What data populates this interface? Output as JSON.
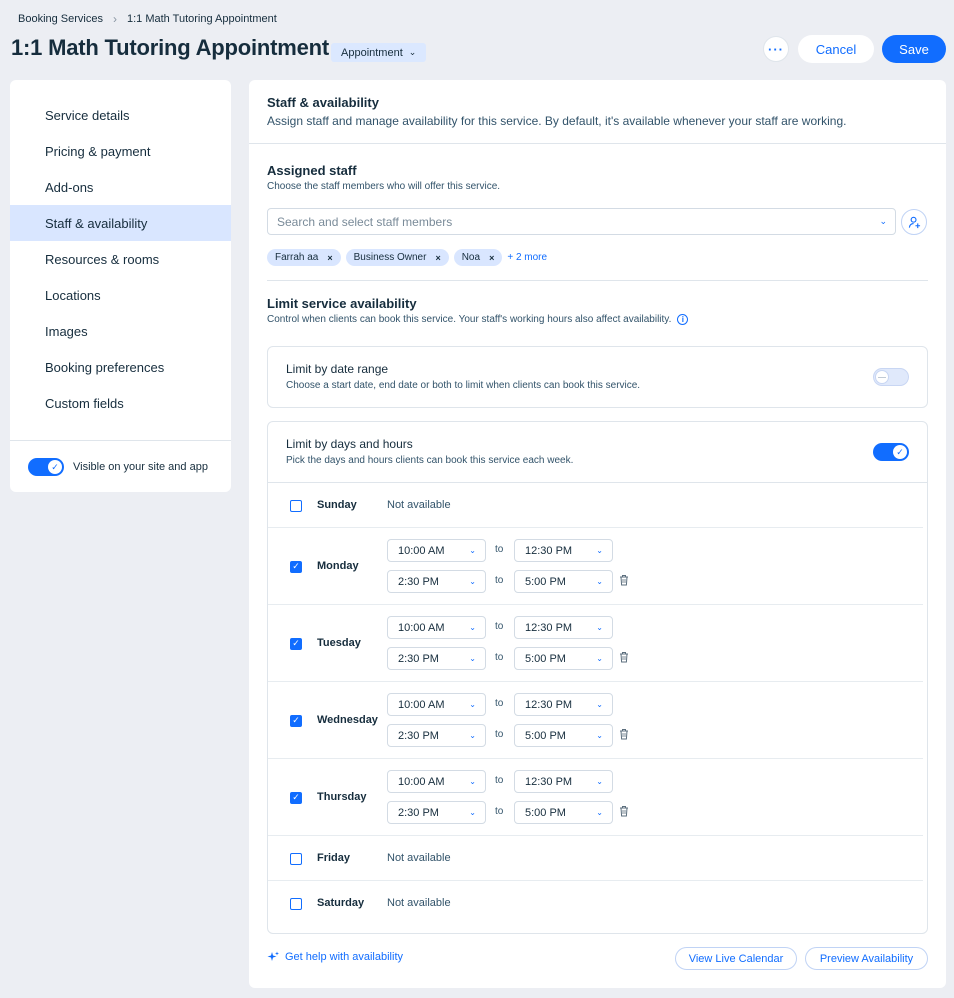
{
  "breadcrumb": {
    "root": "Booking Services",
    "separator": "›",
    "current": "1:1 Math Tutoring Appointment"
  },
  "header": {
    "title": "1:1 Math Tutoring Appointment",
    "type_badge": "Appointment",
    "more_label": "···",
    "cancel_label": "Cancel",
    "save_label": "Save"
  },
  "sidebar": {
    "items": [
      {
        "label": "Service details",
        "active": false
      },
      {
        "label": "Pricing & payment",
        "active": false
      },
      {
        "label": "Add-ons",
        "active": false
      },
      {
        "label": "Staff & availability",
        "active": true
      },
      {
        "label": "Resources & rooms",
        "active": false
      },
      {
        "label": "Locations",
        "active": false
      },
      {
        "label": "Images",
        "active": false
      },
      {
        "label": "Booking preferences",
        "active": false
      },
      {
        "label": "Custom fields",
        "active": false
      }
    ],
    "visible_label": "Visible on your site and app",
    "visible_on": true
  },
  "section": {
    "title": "Staff & availability",
    "subtitle": "Assign staff and manage availability for this service. By default, it's available whenever your staff are working."
  },
  "staff": {
    "title": "Assigned staff",
    "subtitle": "Choose the staff members who will offer this service.",
    "search_placeholder": "Search and select staff members",
    "chips": [
      "Farrah aa",
      "Business Owner",
      "Noa"
    ],
    "more_label": "+ 2 more"
  },
  "limit": {
    "title": "Limit service availability",
    "subtitle": "Control when clients can book this service. Your staff's working hours also affect availability.",
    "date_range": {
      "title": "Limit by date range",
      "subtitle": "Choose a start date, end date or both to limit when clients can book this service.",
      "enabled": false
    },
    "days_hours": {
      "title": "Limit by days and hours",
      "subtitle": "Pick the days and hours clients can book this service each week.",
      "enabled": true
    }
  },
  "to_label": "to",
  "days": [
    {
      "name": "Sunday",
      "checked": false,
      "not_available": "Not available",
      "slots": []
    },
    {
      "name": "Monday",
      "checked": true,
      "slots": [
        {
          "from": "10:00 AM",
          "to": "12:30 PM"
        },
        {
          "from": "2:30 PM",
          "to": "5:00 PM"
        }
      ]
    },
    {
      "name": "Tuesday",
      "checked": true,
      "slots": [
        {
          "from": "10:00 AM",
          "to": "12:30 PM"
        },
        {
          "from": "2:30 PM",
          "to": "5:00 PM"
        }
      ]
    },
    {
      "name": "Wednesday",
      "checked": true,
      "slots": [
        {
          "from": "10:00 AM",
          "to": "12:30 PM"
        },
        {
          "from": "2:30 PM",
          "to": "5:00 PM"
        }
      ]
    },
    {
      "name": "Thursday",
      "checked": true,
      "slots": [
        {
          "from": "10:00 AM",
          "to": "12:30 PM"
        },
        {
          "from": "2:30 PM",
          "to": "5:00 PM"
        }
      ]
    },
    {
      "name": "Friday",
      "checked": false,
      "not_available": "Not available",
      "slots": []
    },
    {
      "name": "Saturday",
      "checked": false,
      "not_available": "Not available",
      "slots": []
    }
  ],
  "footer": {
    "help_label": "Get help with availability",
    "live_calendar_label": "View Live Calendar",
    "preview_label": "Preview Availability"
  },
  "colors": {
    "accent": "#116dff",
    "active_bg": "#d9e6ff",
    "page_bg": "#eceef3"
  }
}
